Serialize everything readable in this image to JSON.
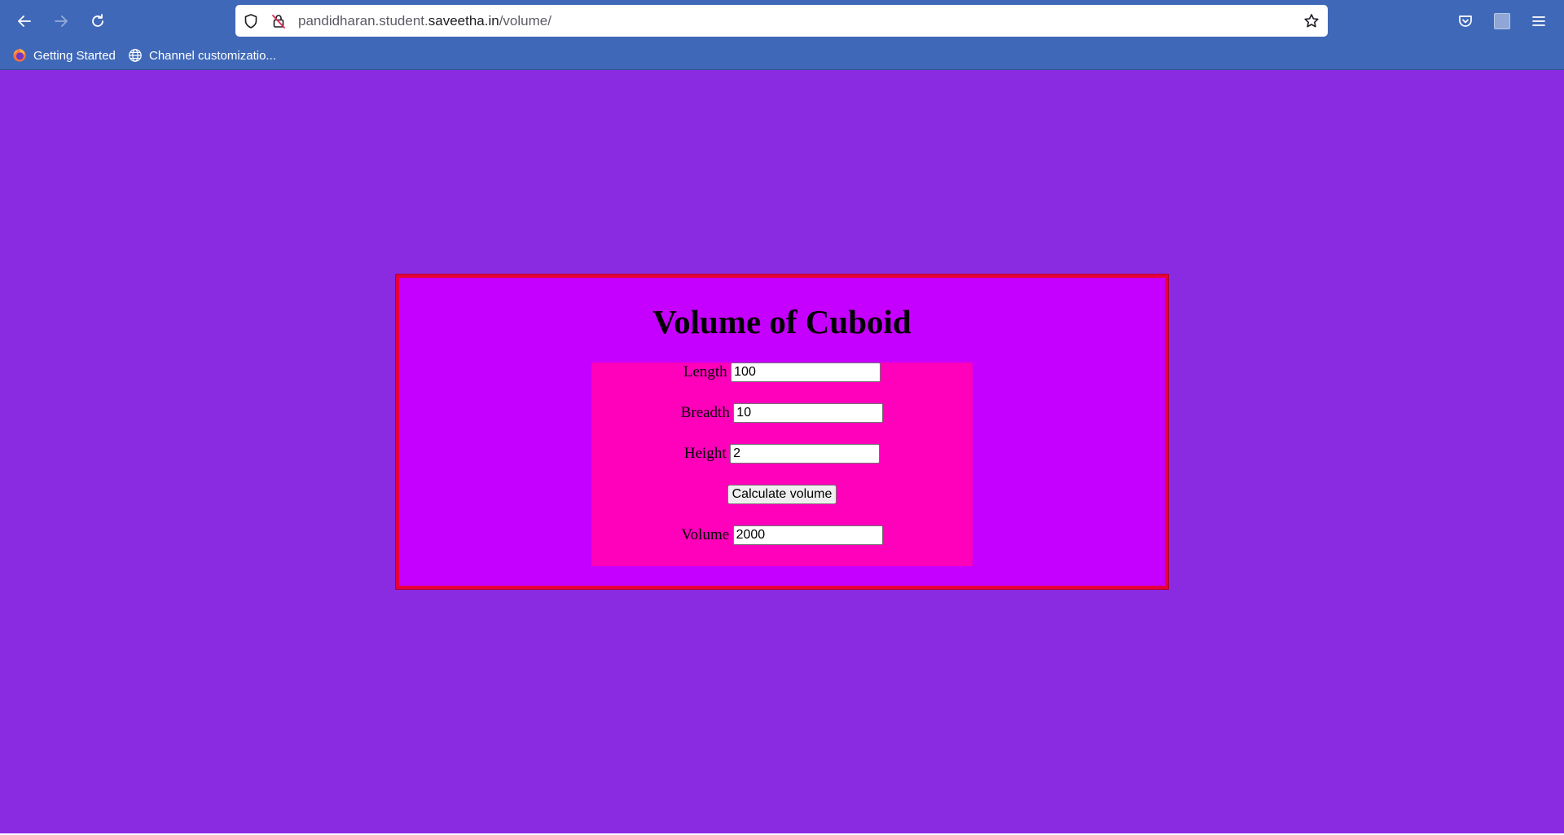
{
  "browser": {
    "url_prefix": "pandidharan.student.",
    "url_domain": "saveetha.in",
    "url_path": "/volume/",
    "bookmarks": [
      {
        "label": "Getting Started",
        "icon": "firefox-icon"
      },
      {
        "label": "Channel customizatio...",
        "icon": "globe-icon"
      }
    ],
    "nav_icons": [
      "back-arrow-icon",
      "forward-arrow-icon",
      "reload-icon"
    ],
    "urlbar_icons": [
      "shield-icon",
      "connection-not-secure-icon",
      "bookmark-star-icon"
    ],
    "toolbar_icons": [
      "pocket-icon",
      "extension-icon",
      "hamburger-menu-icon"
    ]
  },
  "page": {
    "title": "Volume of Cuboid",
    "fields": {
      "length": {
        "label": "Length",
        "value": "100"
      },
      "breadth": {
        "label": "Breadth",
        "value": "10"
      },
      "height": {
        "label": "Height",
        "value": "2"
      },
      "volume": {
        "label": "Volume",
        "value": "2000"
      }
    },
    "calculate_button": "Calculate volume"
  },
  "colors": {
    "toolbar": "#3f69b8",
    "page_background": "#8a2be2",
    "card_background": "#c600ff",
    "card_border": "#e8003a",
    "form_background": "#ff00bb"
  }
}
